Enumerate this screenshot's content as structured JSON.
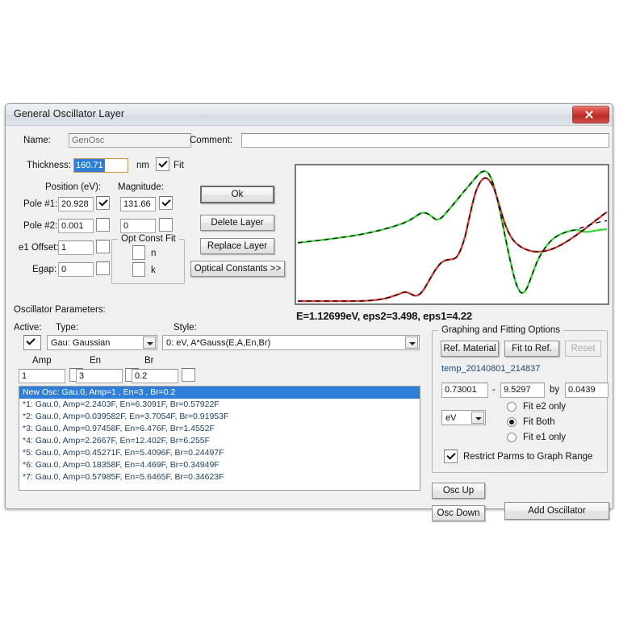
{
  "window": {
    "title": "General Oscillator Layer",
    "close_label": "close"
  },
  "form": {
    "name_label": "Name:",
    "name_value": "GenOsc",
    "comment_label": "Comment:",
    "comment_value": "",
    "thickness_label": "Thickness:",
    "thickness_value": "160.71",
    "thickness_unit": "nm",
    "thickness_fit_label": "Fit",
    "thickness_fit_checked": true,
    "position_header": "Position (eV):",
    "magnitude_header": "Magnitude:",
    "pole1_label": "Pole #1:",
    "pole1_position": "20.928",
    "pole1_position_fit": true,
    "pole1_magnitude": "131.66",
    "pole1_magnitude_fit": true,
    "pole2_label": "Pole #2:",
    "pole2_position": "0.001",
    "pole2_position_fit": false,
    "pole2_magnitude": "0",
    "pole2_magnitude_fit": false,
    "e1offset_label": "e1 Offset:",
    "e1offset_value": "1",
    "e1offset_fit": false,
    "egap_label": "Egap:",
    "egap_value": "0",
    "egap_fit": false,
    "opt_const_fit_group": "Opt Const Fit",
    "opt_n_label": "n",
    "opt_n_checked": false,
    "opt_k_label": "k",
    "opt_k_checked": false
  },
  "buttons": {
    "ok": "Ok",
    "delete_layer": "Delete Layer",
    "replace_layer": "Replace Layer",
    "optical_constants": "Optical Constants >>",
    "osc_up": "Osc Up",
    "osc_down": "Osc Down",
    "add_oscillator": "Add Oscillator"
  },
  "oscillator": {
    "section_label": "Oscillator Parameters:",
    "active_label": "Active:",
    "active_checked": true,
    "type_label": "Type:",
    "type_value": "Gau: Gaussian",
    "style_label": "Style:",
    "style_value": "0: eV, A*Gauss(E,A,En,Br)",
    "amp_label": "Amp",
    "amp_value": "1",
    "amp_fit": false,
    "en_label": "En",
    "en_value": "3",
    "en_fit": false,
    "br_label": "Br",
    "br_value": "0.2",
    "br_fit": false,
    "list": [
      {
        "text": "New Osc: Gau.0, Amp=1 , En=3 , Br=0.2",
        "selected": true
      },
      {
        "text": "*1: Gau.0, Amp=2.2403F, En=6.3091F, Br=0.57922F",
        "selected": false
      },
      {
        "text": "*2: Gau.0, Amp=0.039582F, En=3.7054F, Br=0.91953F",
        "selected": false
      },
      {
        "text": "*3: Gau.0, Amp=0.97458F, En=6.476F, Br=1.4552F",
        "selected": false
      },
      {
        "text": "*4: Gau.0, Amp=2.2667F, En=12.402F, Br=6.255F",
        "selected": false
      },
      {
        "text": "*5: Gau.0, Amp=0.45271F, En=5.4096F, Br=0.24497F",
        "selected": false
      },
      {
        "text": "*6: Gau.0, Amp=0.18358F, En=4.469F, Br=0.34949F",
        "selected": false
      },
      {
        "text": "*7: Gau.0, Amp=0.57985F, En=5.6465F, Br=0.34623F",
        "selected": false
      }
    ]
  },
  "graphing": {
    "group_title": "Graphing and Fitting Options",
    "ref_material": "Ref. Material",
    "fit_to_ref": "Fit to Ref.",
    "reset": "Reset",
    "ref_name": "temp_20140801_214837",
    "range_start": "0.73001",
    "range_dash": "-",
    "range_end": "9.5297",
    "range_by_label": "by",
    "range_step": "0.0439",
    "unit_value": "eV",
    "fit_e2_only": "Fit e2 only",
    "fit_both": "Fit Both",
    "fit_e1_only": "Fit e1 only",
    "fit_selection": "Fit Both",
    "restrict_label": "Restrict Parms to Graph Range",
    "restrict_checked": true
  },
  "graph": {
    "status": "E=1.12699eV, eps2=3.498, eps1=4.22",
    "colors": {
      "green_curve": "#33dd33",
      "red_curve": "#e03a32",
      "model_curve": "#000000",
      "border": "#7a7a7a"
    }
  }
}
